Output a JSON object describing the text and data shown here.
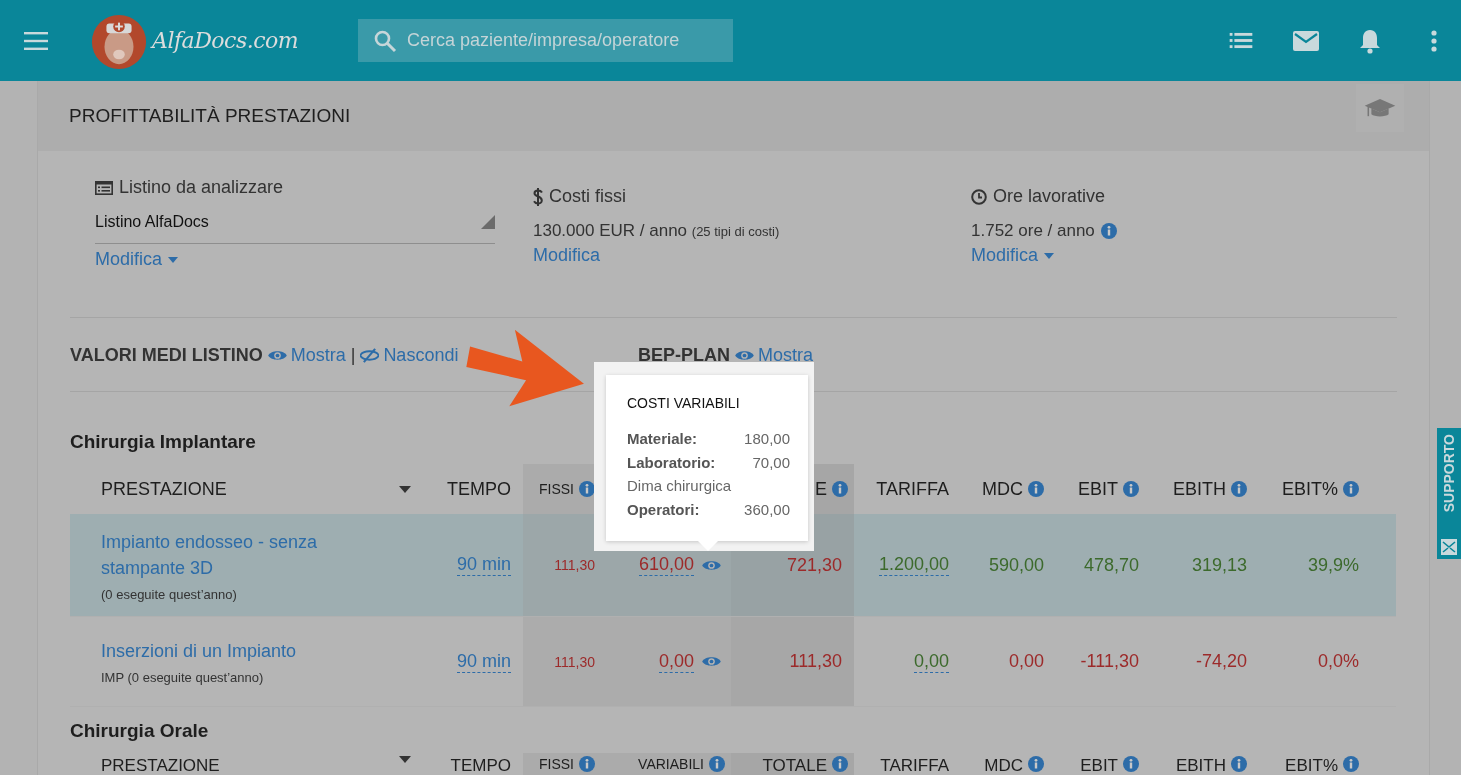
{
  "topbar": {
    "logo_text": "AlfaDocs.com",
    "search_placeholder": "Cerca paziente/impresa/operatore"
  },
  "page": {
    "title": "PROFITTABILITÀ PRESTAZIONI"
  },
  "settings": [
    {
      "kind": "list",
      "label": "Listino da analizzare",
      "value": "Listino AlfaDocs",
      "link": "Modifica",
      "dropdown": true
    },
    {
      "kind": "costs",
      "label": "Costi fissi",
      "value": "130.000 EUR / anno",
      "note": "(25 tipi di costi)",
      "link": "Modifica",
      "dropdown": false
    },
    {
      "kind": "hours",
      "label": "Ore lavorative",
      "value": "1.752 ore / anno",
      "info": true,
      "link": "Modifica",
      "dropdown": true
    }
  ],
  "toggles": [
    {
      "label": "VALORI MEDI LISTINO",
      "actions": [
        {
          "kind": "show",
          "label": "Mostra"
        },
        {
          "kind": "separator",
          "label": "|"
        },
        {
          "kind": "hide",
          "label": "Nascondi"
        }
      ]
    },
    {
      "label": "BEP-PLAN",
      "actions": [
        {
          "kind": "show",
          "label": "Mostra"
        }
      ]
    }
  ],
  "sections": [
    {
      "title": "Chirurgia Implantare",
      "columns": [
        {
          "label": "PRESTAZIONE",
          "sort": true
        },
        {
          "label": "TEMPO"
        },
        {
          "label": "FISSI",
          "info": true
        },
        {},
        {
          "label": "E",
          "info": true
        },
        {
          "label": "TARIFFA"
        },
        {
          "label": "MDC",
          "info": true
        },
        {
          "label": "EBIT",
          "info": true
        },
        {
          "label": "EBITH",
          "info": true
        },
        {
          "label": "EBIT%",
          "info": true
        }
      ],
      "rows": [
        {
          "name": "Impianto endosseo - senza stampante 3D",
          "sub": "(0 eseguite quest’anno)",
          "selected": true,
          "profitable": true,
          "tempo": "90 min",
          "fissi": "111,30",
          "variabili": "610,00",
          "totale": "721,30",
          "tariffa": "1.200,00",
          "mdc": "590,00",
          "ebit": "478,70",
          "ebith": "319,13",
          "ebit_pct": "39,9%"
        },
        {
          "name": "Inserzioni di un Impianto",
          "sub": "IMP (0 eseguite quest’anno)",
          "selected": false,
          "profitable": false,
          "tempo": "90 min",
          "fissi": "111,30",
          "variabili": "0,00",
          "totale": "111,30",
          "tariffa": "0,00",
          "mdc": "0,00",
          "ebit": "-111,30",
          "ebith": "-74,20",
          "ebit_pct": "0,0%"
        }
      ]
    },
    {
      "title": "Chirurgia Orale",
      "columns": [
        {
          "label": "PRESTAZIONE",
          "sort": true
        },
        {
          "label": "TEMPO"
        },
        {
          "label": "FISSI",
          "info": true
        },
        {
          "label": "VARIABILI",
          "info": true
        },
        {
          "label": "TOTALE",
          "info": true
        },
        {
          "label": "TARIFFA"
        },
        {
          "label": "MDC",
          "info": true
        },
        {
          "label": "EBIT",
          "info": true
        },
        {
          "label": "EBITH",
          "info": true
        },
        {
          "label": "EBIT%",
          "info": true
        }
      ]
    }
  ],
  "tooltip": {
    "title": "COSTI VARIABILI",
    "lines": [
      {
        "kind": "item",
        "label": "Materiale:",
        "value": "180,00"
      },
      {
        "kind": "item",
        "label": "Laboratorio:",
        "value": "70,00"
      },
      {
        "kind": "note",
        "text": "Dima chirurgica"
      },
      {
        "kind": "item",
        "label": "Operatori:",
        "value": "360,00"
      }
    ]
  },
  "support_tab": {
    "label": "SUPPORTO"
  }
}
